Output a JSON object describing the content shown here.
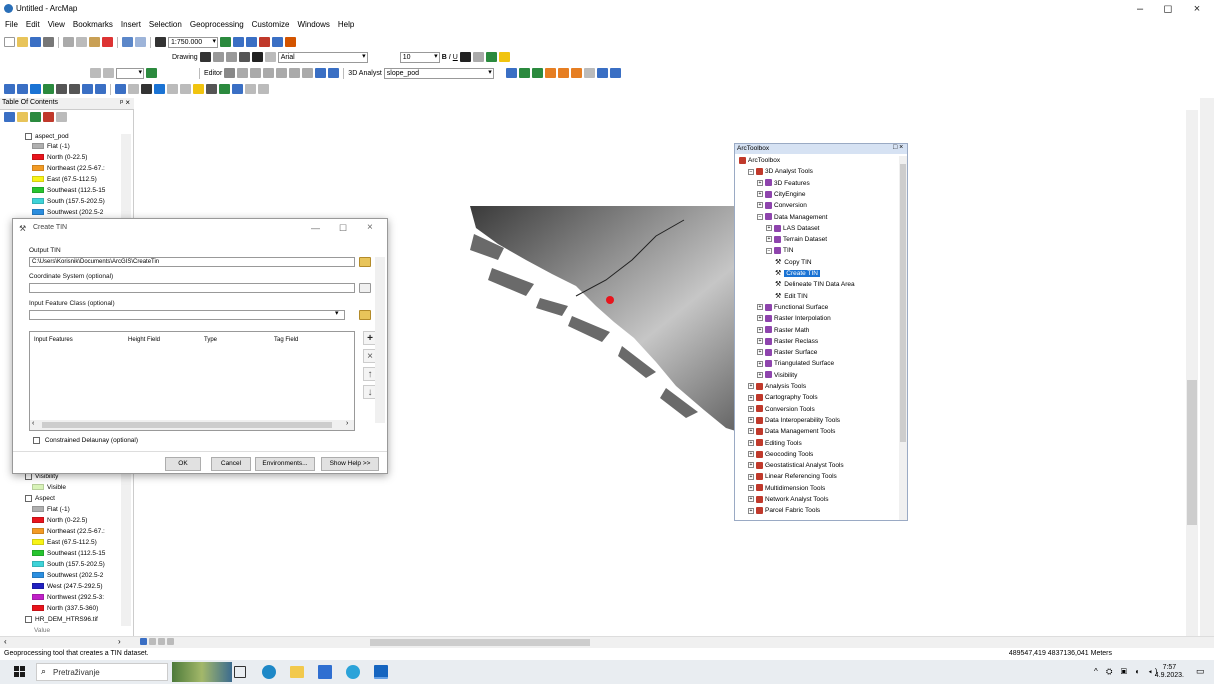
{
  "window": {
    "title": "Untitled - ArcMap",
    "minimize": "–",
    "maximize": "◻",
    "close": "×"
  },
  "menu": [
    "File",
    "Edit",
    "View",
    "Bookmarks",
    "Insert",
    "Selection",
    "Geoprocessing",
    "Customize",
    "Windows",
    "Help"
  ],
  "toolbar": {
    "scale": "1:750.000",
    "drawing_label": "Drawing",
    "font": "Arial",
    "font_size": "10",
    "editor_label": "Editor",
    "analyst_label": "3D Analyst",
    "layer_select": "slope_pod"
  },
  "toc": {
    "title": "Table Of Contents",
    "items_top": [
      {
        "label": "aspect_pod",
        "kind": "layer"
      },
      {
        "label": "Flat (-1)",
        "color": "#b0b0b0"
      },
      {
        "label": "North (0-22.5)",
        "color": "#e8141c"
      },
      {
        "label": "Northeast (22.5-67.:",
        "color": "#f29b25"
      },
      {
        "label": "East (67.5-112.5)",
        "color": "#f7f316"
      },
      {
        "label": "Southeast (112.5-15",
        "color": "#27c42f"
      },
      {
        "label": "South (157.5-202.5)",
        "color": "#3ed3d8"
      },
      {
        "label": "Southwest (202.5-2",
        "color": "#2c8fe0"
      }
    ],
    "items_bottom": [
      {
        "label": "Visibility",
        "kind": "layer"
      },
      {
        "label": "Visible",
        "color": "#d8f3b8"
      },
      {
        "label": "Aspect",
        "kind": "layer"
      },
      {
        "label": "Flat (-1)",
        "color": "#b0b0b0"
      },
      {
        "label": "North (0-22.5)",
        "color": "#e8141c"
      },
      {
        "label": "Northeast (22.5-67.:",
        "color": "#f29b25"
      },
      {
        "label": "East (67.5-112.5)",
        "color": "#f7f316"
      },
      {
        "label": "Southeast (112.5-15",
        "color": "#27c42f"
      },
      {
        "label": "South (157.5-202.5)",
        "color": "#3ed3d8"
      },
      {
        "label": "Southwest (202.5-2",
        "color": "#2c8fe0"
      },
      {
        "label": "West (247.5-292.5)",
        "color": "#2020c0"
      },
      {
        "label": "Northwest (292.5-3:",
        "color": "#c020c8"
      },
      {
        "label": "North (337.5-360)",
        "color": "#e8141c"
      },
      {
        "label": "HR_DEM_HTRS96.tif",
        "kind": "layer"
      },
      {
        "label": "Value",
        "kind": "text"
      }
    ]
  },
  "dialog": {
    "title": "Create TIN",
    "output_label": "Output TIN",
    "output_value": "C:\\Users\\Korisnik\\Documents\\ArcGIS\\CreateTin",
    "coord_label": "Coordinate System (optional)",
    "input_fc_label": "Input Feature Class (optional)",
    "columns": [
      "Input Features",
      "Height Field",
      "Type",
      "Tag Field"
    ],
    "constrained_label": "Constrained Delaunay (optional)",
    "ok": "OK",
    "cancel": "Cancel",
    "environments": "Environments...",
    "show_help": "Show Help >>"
  },
  "arctoolbox": {
    "title": "ArcToolbox",
    "items": [
      {
        "label": "ArcToolbox",
        "level": 0,
        "kind": "root"
      },
      {
        "label": "3D Analyst Tools",
        "level": 1,
        "kind": "box",
        "exp": "−"
      },
      {
        "label": "3D Features",
        "level": 2,
        "kind": "set",
        "exp": "+"
      },
      {
        "label": "CityEngine",
        "level": 2,
        "kind": "set",
        "exp": "+"
      },
      {
        "label": "Conversion",
        "level": 2,
        "kind": "set",
        "exp": "+"
      },
      {
        "label": "Data Management",
        "level": 2,
        "kind": "set",
        "exp": "−"
      },
      {
        "label": "LAS Dataset",
        "level": 3,
        "kind": "set",
        "exp": "+"
      },
      {
        "label": "Terrain Dataset",
        "level": 3,
        "kind": "set",
        "exp": "+"
      },
      {
        "label": "TIN",
        "level": 3,
        "kind": "set",
        "exp": "−"
      },
      {
        "label": "Copy TIN",
        "level": 4,
        "kind": "tool"
      },
      {
        "label": "Create TIN",
        "level": 4,
        "kind": "tool",
        "selected": true
      },
      {
        "label": "Delineate TIN Data Area",
        "level": 4,
        "kind": "tool"
      },
      {
        "label": "Edit TIN",
        "level": 4,
        "kind": "tool"
      },
      {
        "label": "Functional Surface",
        "level": 2,
        "kind": "set",
        "exp": "+"
      },
      {
        "label": "Raster Interpolation",
        "level": 2,
        "kind": "set",
        "exp": "+"
      },
      {
        "label": "Raster Math",
        "level": 2,
        "kind": "set",
        "exp": "+"
      },
      {
        "label": "Raster Reclass",
        "level": 2,
        "kind": "set",
        "exp": "+"
      },
      {
        "label": "Raster Surface",
        "level": 2,
        "kind": "set",
        "exp": "+"
      },
      {
        "label": "Triangulated Surface",
        "level": 2,
        "kind": "set",
        "exp": "+"
      },
      {
        "label": "Visibility",
        "level": 2,
        "kind": "set",
        "exp": "+"
      },
      {
        "label": "Analysis Tools",
        "level": 1,
        "kind": "box",
        "exp": "+"
      },
      {
        "label": "Cartography Tools",
        "level": 1,
        "kind": "box",
        "exp": "+"
      },
      {
        "label": "Conversion Tools",
        "level": 1,
        "kind": "box",
        "exp": "+"
      },
      {
        "label": "Data Interoperability Tools",
        "level": 1,
        "kind": "box",
        "exp": "+"
      },
      {
        "label": "Data Management Tools",
        "level": 1,
        "kind": "box",
        "exp": "+"
      },
      {
        "label": "Editing Tools",
        "level": 1,
        "kind": "box",
        "exp": "+"
      },
      {
        "label": "Geocoding Tools",
        "level": 1,
        "kind": "box",
        "exp": "+"
      },
      {
        "label": "Geostatistical Analyst Tools",
        "level": 1,
        "kind": "box",
        "exp": "+"
      },
      {
        "label": "Linear Referencing Tools",
        "level": 1,
        "kind": "box",
        "exp": "+"
      },
      {
        "label": "Multidimension Tools",
        "level": 1,
        "kind": "box",
        "exp": "+"
      },
      {
        "label": "Network Analyst Tools",
        "level": 1,
        "kind": "box",
        "exp": "+"
      },
      {
        "label": "Parcel Fabric Tools",
        "level": 1,
        "kind": "box",
        "exp": "+"
      }
    ]
  },
  "status": {
    "message": "Geoprocessing tool that creates a TIN dataset.",
    "coords": "489547,419  4837136,041 Meters"
  },
  "taskbar": {
    "search_placeholder": "Pretraživanje",
    "time": "7:57",
    "date": "4.9.2023."
  },
  "colors": {
    "accent": "#1a73d4",
    "toolbox_red": "#c0392b",
    "folder": "#e8c45a"
  }
}
